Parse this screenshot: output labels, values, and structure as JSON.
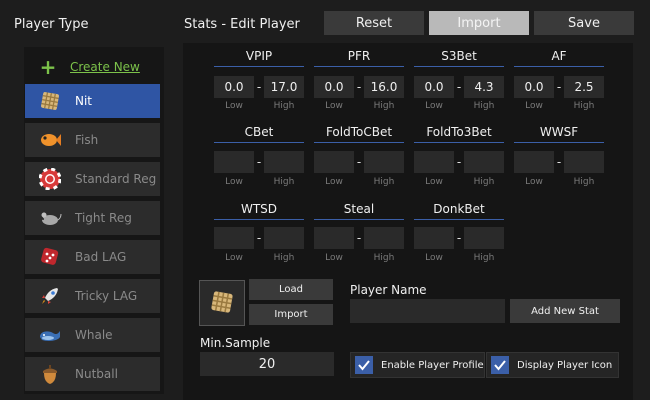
{
  "sidebar": {
    "title": "Player Type",
    "create_new": "Create New",
    "items": [
      {
        "label": "Nit",
        "icon": "waffle-icon",
        "selected": true
      },
      {
        "label": "Fish",
        "icon": "fish-icon"
      },
      {
        "label": "Standard Reg",
        "icon": "poker-chip-icon"
      },
      {
        "label": "Tight Reg",
        "icon": "mouse-icon"
      },
      {
        "label": "Bad LAG",
        "icon": "dice-icon"
      },
      {
        "label": "Tricky LAG",
        "icon": "rocket-icon"
      },
      {
        "label": "Whale",
        "icon": "whale-icon"
      },
      {
        "label": "Nutball",
        "icon": "acorn-icon"
      }
    ]
  },
  "header": {
    "title": "Stats - Edit Player",
    "reset": "Reset",
    "import": "Import",
    "save": "Save"
  },
  "stats": {
    "low_label": "Low",
    "high_label": "High",
    "dash": "-",
    "items": [
      {
        "name": "VPIP",
        "low": "0.0",
        "high": "17.0"
      },
      {
        "name": "PFR",
        "low": "0.0",
        "high": "16.0"
      },
      {
        "name": "S3Bet",
        "low": "0.0",
        "high": "4.3"
      },
      {
        "name": "AF",
        "low": "0.0",
        "high": "2.5"
      },
      {
        "name": "CBet",
        "low": "",
        "high": ""
      },
      {
        "name": "FoldToCBet",
        "low": "",
        "high": ""
      },
      {
        "name": "FoldTo3Bet",
        "low": "",
        "high": ""
      },
      {
        "name": "WWSF",
        "low": "",
        "high": ""
      },
      {
        "name": "WTSD",
        "low": "",
        "high": ""
      },
      {
        "name": "Steal",
        "low": "",
        "high": ""
      },
      {
        "name": "DonkBet",
        "low": "",
        "high": ""
      }
    ]
  },
  "icon_panel": {
    "load": "Load",
    "import": "Import",
    "current_icon": "waffle-icon"
  },
  "player_name": {
    "label": "Player Name",
    "value": "",
    "add_stat": "Add New Stat"
  },
  "min_sample": {
    "label": "Min.Sample",
    "value": "20"
  },
  "options": {
    "enable_profile": {
      "label": "Enable Player Profile",
      "checked": true
    },
    "display_icon": {
      "label": "Display Player Icon",
      "checked": true
    }
  },
  "colors": {
    "accent": "#2f55a4",
    "create_green": "#7cc24a",
    "background": "#1d1d1d"
  }
}
